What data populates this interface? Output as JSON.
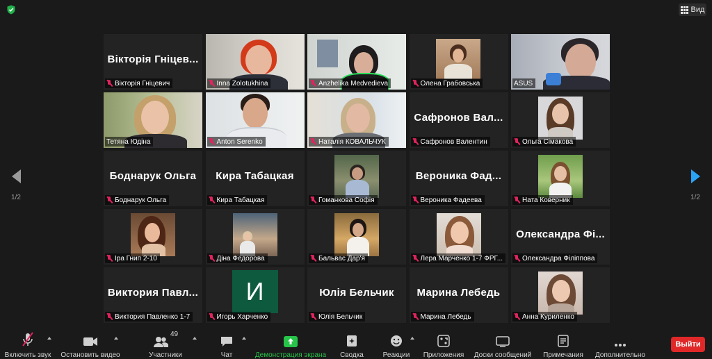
{
  "view_button": {
    "label": "Вид"
  },
  "pagination": {
    "left": "1/2",
    "right": "1/2"
  },
  "participants": [
    {
      "big": "Вікторія Гніцев...",
      "label": "Вікторія Гніцевич"
    },
    {
      "big": "",
      "label": "Inna Zolotukhina"
    },
    {
      "big": "",
      "label": "Anzhelika Medvedieva"
    },
    {
      "big": "",
      "label": "Олена Грабовська"
    },
    {
      "big": "",
      "label": "ASUS"
    },
    {
      "big": "",
      "label": "Тетяна Юдіна"
    },
    {
      "big": "",
      "label": "Anton Serenko"
    },
    {
      "big": "",
      "label": "Наталія КОВАЛЬЧУК"
    },
    {
      "big": "Сафронов  Вал...",
      "label": "Сафронов Валентин"
    },
    {
      "big": "",
      "label": "Ольга Сімакова"
    },
    {
      "big": "Боднарук Ольга",
      "label": "Боднарук Ольга"
    },
    {
      "big": "Кира Табацкая",
      "label": "Кира Табацкая"
    },
    {
      "big": "",
      "label": "Гоманкова Софія"
    },
    {
      "big": "Вероника  Фад...",
      "label": "Вероника Фадеева"
    },
    {
      "big": "",
      "label": "Ната Коверник"
    },
    {
      "big": "",
      "label": "Іра Гнип 2-10"
    },
    {
      "big": "",
      "label": "Діна Федорова"
    },
    {
      "big": "",
      "label": "Бальвас Дар'я"
    },
    {
      "big": "",
      "label": "Лера Марченко 1-7 ФРГ..."
    },
    {
      "big": "Олександра  Фі...",
      "label": "Олександра Філіппова"
    },
    {
      "big": "Виктория  Павл...",
      "label": "Виктория Павленко 1-7"
    },
    {
      "big": "И",
      "label": "Игорь Харченко"
    },
    {
      "big": "Юлія Бельчик",
      "label": "Юлія Бельчик"
    },
    {
      "big": "Марина Лебедь",
      "label": "Марина Лебедь"
    },
    {
      "big": "",
      "label": "Анна Куриленко"
    }
  ],
  "toolbar": {
    "unmute": "Включить звук",
    "stop_video": "Остановить видео",
    "participants": "Участники",
    "participants_count": "49",
    "chat": "Чат",
    "share": "Демонстрация экрана",
    "whiteboard": "Сводка",
    "reactions": "Реакции",
    "apps": "Приложения",
    "boards": "Доски сообщений",
    "notes": "Примечания",
    "more": "Дополнительно",
    "leave": "Выйти"
  },
  "colors": {
    "share_green": "#27c44a",
    "active_speaker": "#c8e61c",
    "leave_red": "#e02828",
    "muted_red": "#e0245e"
  }
}
